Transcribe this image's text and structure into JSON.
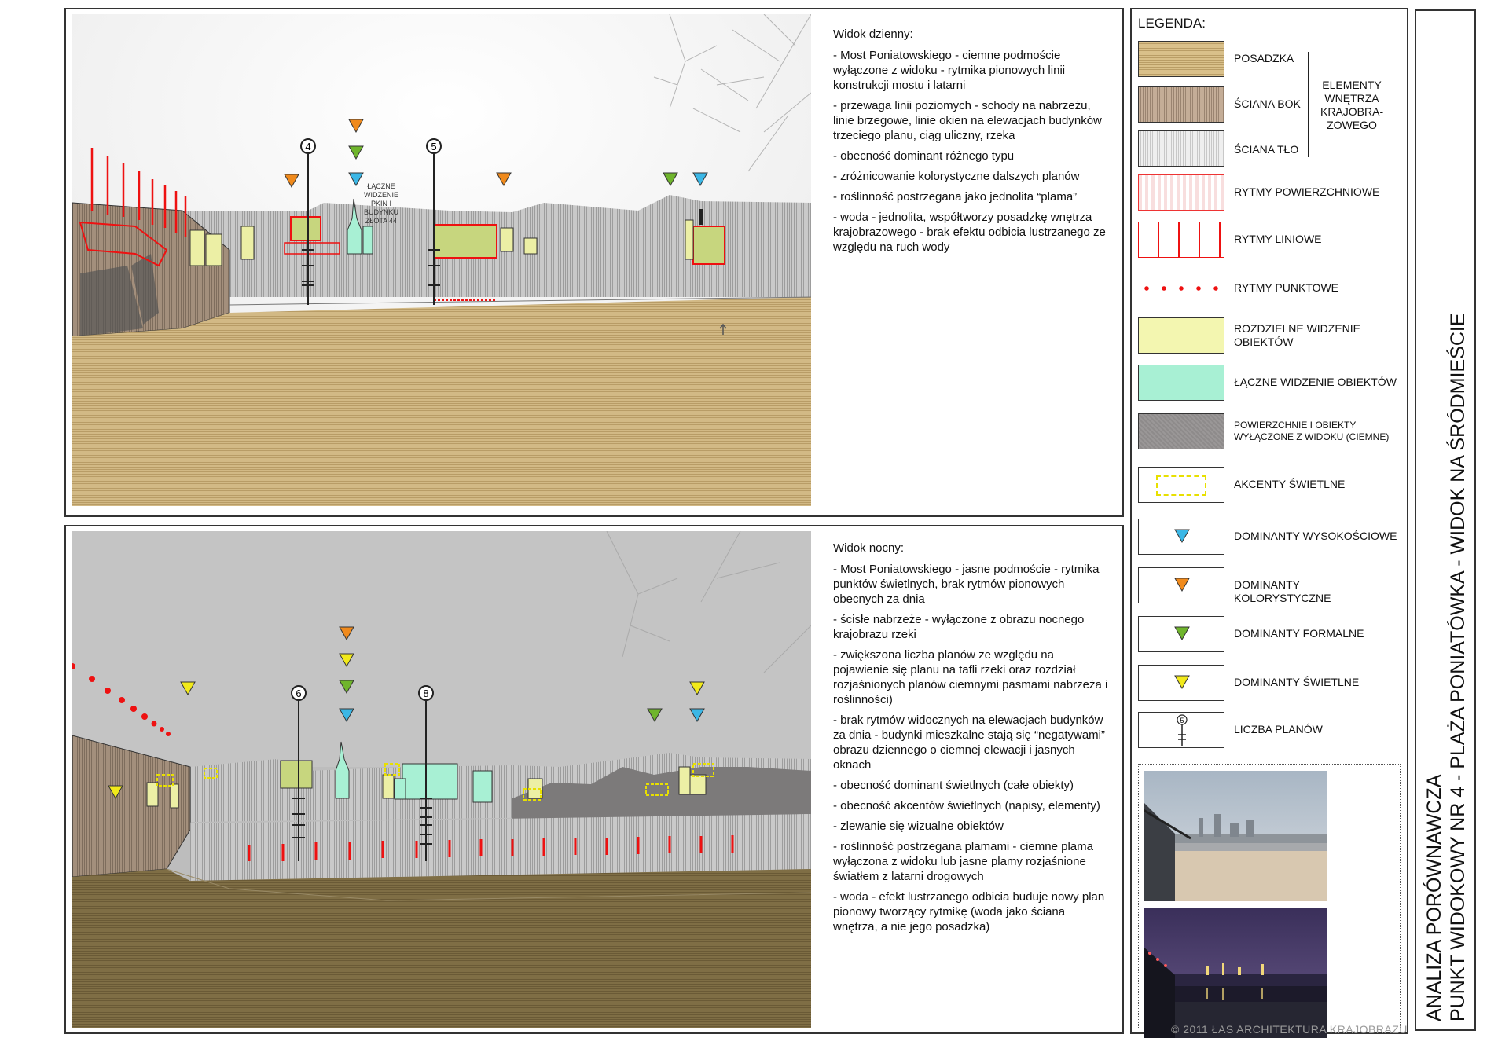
{
  "day": {
    "title": "Widok dzienny:",
    "points": [
      "- Most Poniatowskiego - ciemne podmoście wyłączone z widoku - rytmika pionowych linii konstrukcji mostu i latarni",
      "- przewaga linii poziomych - schody na nabrzeżu, linie brzegowe, linie okien na elewacjach budynków trzeciego planu, ciąg uliczny, rzeka",
      "- obecność dominant różnego typu",
      "- zróżnicowanie kolorystyczne dalszych planów",
      "- roślinność postrzegana jako jednolita “plama”",
      "- woda - jednolita, współtworzy posadzkę wnętrza krajobrazowego - brak efektu odbicia lustrzanego ze względu na ruch wody"
    ],
    "plan_markers": [
      "4",
      "5"
    ],
    "annotation": [
      "ŁĄCZNE",
      "WIDZENIE",
      "PKIN I",
      "BUDYNKU",
      "ZŁOTA 44"
    ]
  },
  "night": {
    "title": "Widok nocny:",
    "points": [
      "- Most Poniatowskiego - jasne podmoście - rytmika punktów świetlnych, brak rytmów pionowych obecnych za dnia",
      "- ścisłe nabrzeże - wyłączone z obrazu nocnego krajobrazu rzeki",
      "- zwiększona liczba planów ze względu na pojawienie się planu na tafli rzeki oraz rozdział rozjaśnionych planów ciemnymi pasmami nabrzeża i roślinności)",
      "- brak rytmów widocznych na elewacjach budynków za dnia - budynki mieszkalne stają się “negatywami” obrazu dziennego o ciemnej elewacji i jasnych oknach",
      "- obecność dominant świetlnych (całe obiekty)",
      "- obecność akcentów świetlnych (napisy, elementy)",
      "- zlewanie się wizualne obiektów",
      "- roślinność postrzegana plamami - ciemne plama wyłączona z widoku lub jasne plamy rozjaśnione światłem z latarni drogowych",
      "- woda -  efekt lustrzanego odbicia buduje nowy plan pionowy tworzący rytmikę (woda jako ściana wnętrza, a nie jego posadzka)"
    ],
    "plan_markers": [
      "6",
      "8"
    ]
  },
  "legend": {
    "title": "LEGENDA:",
    "group_label": [
      "ELEMENTY",
      "WNĘTRZA",
      "KRAJOBRA-",
      "ZOWEGO"
    ],
    "items": [
      {
        "label": "POSADZKA",
        "color": "#d9c08a"
      },
      {
        "label": "ŚCIANA BOK",
        "color": "#c4ad97"
      },
      {
        "label": "ŚCIANA TŁO",
        "color": "#ececec"
      },
      {
        "label": "RYTMY POWIERZCHNIOWE",
        "color": "#e33"
      },
      {
        "label": "RYTMY LINIOWE",
        "color": "#e11"
      },
      {
        "label": "RYTMY PUNKTOWE",
        "color": "#e11"
      },
      {
        "label": "ROZDZIELNE WIDZENIE OBIEKTÓW",
        "color": "#f3f6b0"
      },
      {
        "label": "ŁĄCZNE WIDZENIE OBIEKTÓW",
        "color": "#a8f0d4"
      },
      {
        "label": "POWIERZCHNIE I OBIEKTY WYŁĄCZONE Z WIDOKU (CIEMNE)",
        "color": "#9a9797"
      },
      {
        "label": "AKCENTY ŚWIETLNE",
        "color": "#e8e000"
      },
      {
        "label": "DOMINANTY WYSOKOŚCIOWE",
        "color": "#3bb7e6"
      },
      {
        "label": "DOMINANTY KOLORYSTYCZNE",
        "color": "#f08a1c"
      },
      {
        "label": "DOMINANTY FORMALNE",
        "color": "#6fb52c"
      },
      {
        "label": "DOMINANTY ŚWIETLNE",
        "color": "#f2ea1a"
      },
      {
        "label": "LICZBA PLANÓW",
        "color": "#222"
      }
    ],
    "plan_marker_example": "5"
  },
  "vertical_title": [
    "ANALIZA PORÓWNAWCZA",
    "PUNKT WIDOKOWY NR 4 - PLAŻA PONIATÓWKA - WIDOK NA ŚRÓDMIEŚCIE"
  ],
  "copyright": "© 2011 ŁAS ARCHITEKTURA KRAJOBRAZU"
}
